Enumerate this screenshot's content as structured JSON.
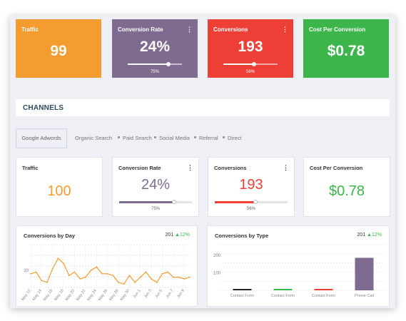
{
  "top_kpis": [
    {
      "title": "Traffic",
      "value": "99",
      "color": "#f59c30",
      "has_menu": false
    },
    {
      "title": "Conversion Rate",
      "value": "24%",
      "color": "#7f6b8f",
      "has_menu": true,
      "progress": 0.75,
      "progress_label": "75%"
    },
    {
      "title": "Conversions",
      "value": "193",
      "color": "#ee3f37",
      "has_menu": true,
      "progress": 0.56,
      "progress_label": "56%"
    },
    {
      "title": "Cost Per Conversion",
      "value": "$0.78",
      "color": "#3cb54a",
      "has_menu": false
    }
  ],
  "channels": {
    "heading": "CHANNELS"
  },
  "tabs": {
    "active": "Google Adwords",
    "items": [
      "Organic Search",
      "Paid Search",
      "Social Media",
      "Referral",
      "Direct"
    ]
  },
  "kpis": [
    {
      "title": "Traffic",
      "value": "100",
      "value_color": "#f59c30"
    },
    {
      "title": "Conversion Rate",
      "value": "24%",
      "value_color": "#7f6b8f",
      "progress": 0.75,
      "progress_label": "75%",
      "bar_color": "#7f6b8f"
    },
    {
      "title": "Conversions",
      "value": "193",
      "value_color": "#ee3f37",
      "progress": 0.56,
      "progress_label": "56%",
      "bar_color": "#ee3f37"
    },
    {
      "title": "Cost Per Conversion",
      "value": "$0.78",
      "value_color": "#3cb54a"
    }
  ],
  "menu_glyph": "⋮",
  "conversions_by_day": {
    "title": "Conversions by Day",
    "total": "201",
    "change": "12%",
    "chart_data": {
      "type": "line",
      "x": [
        "May 12",
        "May 13",
        "May 14",
        "May 15",
        "May 16",
        "May 17",
        "May 18",
        "May 19",
        "May 20",
        "May 21",
        "May 22",
        "May 23",
        "May 24",
        "May 25",
        "May 26",
        "May 27",
        "May 28",
        "May 29",
        "May 30",
        "May 31",
        "Jun 1",
        "Jun 2",
        "Jun 3",
        "Jun 4",
        "Jun 5",
        "Jun 6",
        "Jun 7",
        "Jun 8",
        "Jun 9",
        "Jun 10"
      ],
      "x_tick_labels": [
        "May 12",
        "May 14",
        "May 16",
        "May 18",
        "May 20",
        "May 22",
        "May 24",
        "May 26",
        "May 28",
        "May 30",
        "Jun 1",
        "Jun 3",
        "Jun 5",
        "Jun 7",
        "Jun 9"
      ],
      "series": [
        {
          "values": [
            8,
            9,
            4,
            3,
            11,
            17,
            14,
            7,
            9,
            5,
            6,
            10,
            12,
            8,
            8,
            7,
            3,
            2,
            7,
            3,
            6,
            9,
            5,
            3,
            8,
            9,
            6,
            6,
            5,
            6
          ]
        }
      ],
      "y_tick_labels": [
        "10"
      ],
      "ylim": [
        0,
        25
      ],
      "color": "#f59c30",
      "grid": true
    }
  },
  "conversions_by_type": {
    "title": "Conversions by Type",
    "total": "201",
    "change": "12%",
    "chart_data": {
      "type": "bar",
      "categories": [
        "Contact Form",
        "Contact Form",
        "Contact Form",
        "Phone Call"
      ],
      "values": [
        4,
        6,
        7,
        185
      ],
      "colors": [
        "#222222",
        "#3cb54a",
        "#ee3f37",
        "#7f6b8f"
      ],
      "y_tick_labels": [
        "100",
        "200"
      ],
      "ylim": [
        0,
        260
      ],
      "grid": true
    }
  }
}
